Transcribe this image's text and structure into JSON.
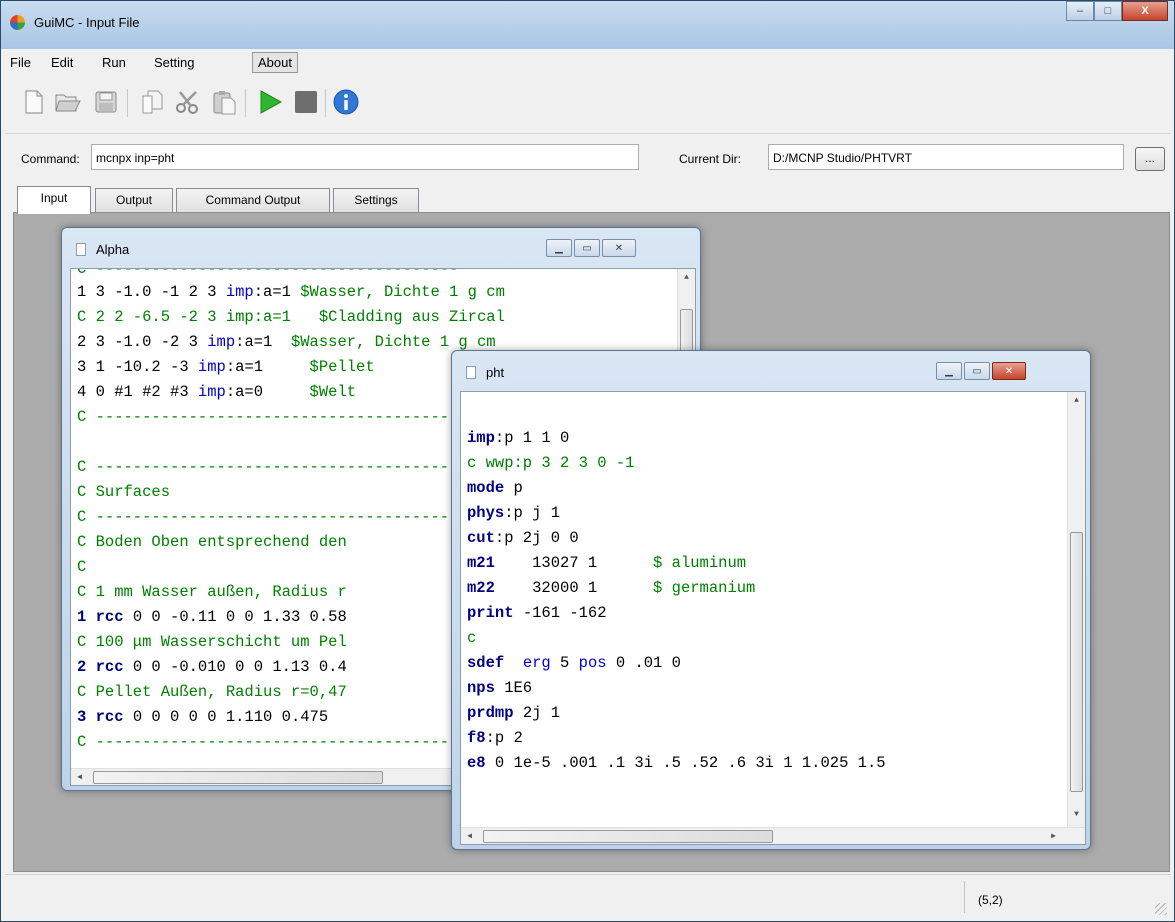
{
  "window": {
    "title": "GuiMC - Input File",
    "minimize": "–",
    "maximize": "□",
    "close": "X"
  },
  "menu": [
    "File",
    "Edit",
    "Run",
    "Setting",
    "About"
  ],
  "toolbar": {
    "icons": [
      "new-file-icon",
      "open-folder-icon",
      "save-icon",
      "copy-icon",
      "cut-icon",
      "paste-icon",
      "run-play-icon",
      "stop-icon",
      "info-icon"
    ]
  },
  "command": {
    "label": "Command:",
    "value": "mcnpx inp=pht"
  },
  "current_dir": {
    "label": "Current Dir:",
    "value": "D:/MCNP Studio/PHTVRT",
    "browse_label": "..."
  },
  "tabs": [
    "Input",
    "Output",
    "Command Output",
    "Settings"
  ],
  "status": {
    "position": "(5,2)"
  },
  "alpha": {
    "title": "Alpha",
    "lines": [
      "C ---------------------------------------",
      "1 3 -1.0 -1 2 3 imp:a=1 $Wasser, Dichte 1 g cm",
      "C 2 2 -6.5 -2 3 imp:a=1   $Cladding aus Zircal",
      "2 3 -1.0 -2 3 imp:a=1  $Wasser, Dichte 1 g cm",
      "3 1 -10.2 -3 imp:a=1     $Pellet",
      "4 0 #1 #2 #3 imp:a=0     $Welt",
      "C ---------------------------------------",
      "",
      "C ---------------------------------------",
      "C Surfaces",
      "C ---------------------------------------",
      "C Boden Oben entsprechend den",
      "C",
      "C 1 mm Wasser außen, Radius r",
      "1 rcc 0 0 -0.11 0 0 1.33 0.58",
      "C 100 μm Wasserschicht um Pel",
      "2 rcc 0 0 -0.010 0 0 1.13 0.4",
      "C Pellet Außen, Radius r=0,47",
      "3 rcc 0 0 0 0 0 1.110 0.475",
      "C ---------------------------------------"
    ]
  },
  "pht": {
    "title": "pht",
    "lines": [
      "",
      "imp:p 1 1 0",
      "c wwp:p 3 2 3 0 -1",
      "mode p",
      "phys:p j 1",
      "cut:p 2j 0 0",
      "m21    13027 1      $ aluminum",
      "m22    32000 1      $ germanium",
      "print -161 -162",
      "c",
      "sdef  erg 5 pos 0 .01 0",
      "nps 1E6",
      "prdmp 2j 1",
      "f8:p 2",
      "e8 0 1e-5 .001 .1 3i .5 .52 .6 3i 1 1.025 1.5"
    ]
  }
}
